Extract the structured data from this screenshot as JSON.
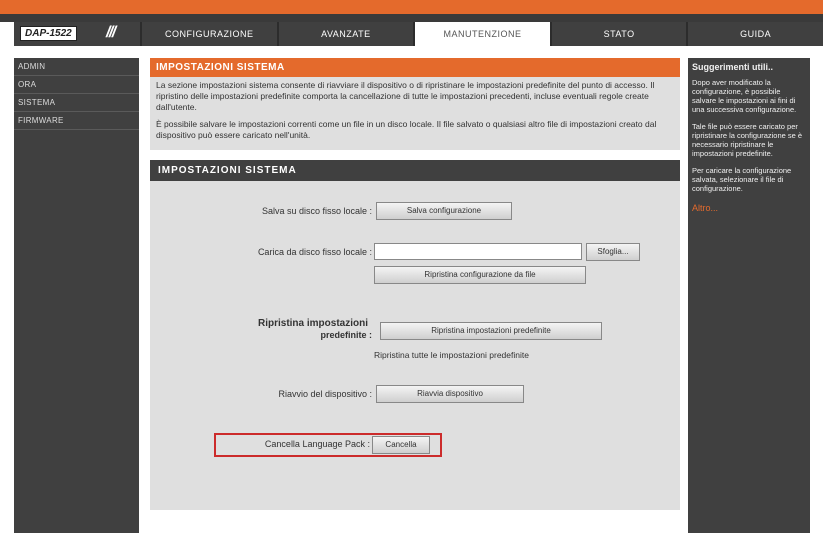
{
  "header": {
    "model": "DAP-1522",
    "tabs": [
      {
        "label": "CONFIGURAZIONE",
        "active": false
      },
      {
        "label": "AVANZATE",
        "active": false
      },
      {
        "label": "MANUTENZIONE",
        "active": true
      },
      {
        "label": "STATO",
        "active": false
      },
      {
        "label": "GUIDA",
        "active": false
      }
    ]
  },
  "sidebar": {
    "items": [
      {
        "label": "ADMIN"
      },
      {
        "label": "ORA"
      },
      {
        "label": "SISTEMA"
      },
      {
        "label": "FIRMWARE"
      }
    ]
  },
  "main": {
    "intro": {
      "title": "IMPOSTAZIONI SISTEMA",
      "p1": "La sezione impostazioni sistema consente di riavviare il dispositivo o di ripristinare le impostazioni predefinite del punto di accesso. Il ripristino delle impostazioni predefinite comporta la cancellazione di tutte le impostazioni precedenti, incluse eventuali regole create dall'utente.",
      "p2": "È possibile salvare le impostazioni correnti come un file in un disco locale. Il file salvato o qualsiasi altro file di impostazioni creato dal dispositivo può essere caricato nell'unità."
    },
    "panel": {
      "title": "IMPOSTAZIONI SISTEMA",
      "save_label": "Salva su disco fisso locale :",
      "save_button": "Salva configurazione",
      "load_label": "Carica da disco fisso locale :",
      "browse_button": "Sfoglia...",
      "restore_file_button": "Ripristina configurazione da file",
      "restore_label_1": "Ripristina impostazioni",
      "restore_label_2": "predefinite :",
      "restore_button": "Ripristina impostazioni predefinite",
      "restore_note": "Ripristina tutte le impostazioni predefinite",
      "reboot_label": "Riavvio del dispositivo :",
      "reboot_button": "Riavvia dispositivo",
      "clear_lang_label": "Cancella Language Pack :",
      "clear_lang_button": "Cancella"
    }
  },
  "help": {
    "title": "Suggerimenti utili..",
    "p1": "Dopo aver modificato la configurazione, è possibile salvare le impostazioni ai fini di una successiva configurazione.",
    "p2": "Tale file può essere caricato per ripristinare la configurazione se è necessario ripristinare le impostazioni predefinite.",
    "p3": "Per caricare la configurazione salvata, selezionare il file di configurazione.",
    "more": "Altro..."
  },
  "colors": {
    "accent": "#e46a2c",
    "dark": "#404040",
    "highlight": "#cc2b2b"
  }
}
